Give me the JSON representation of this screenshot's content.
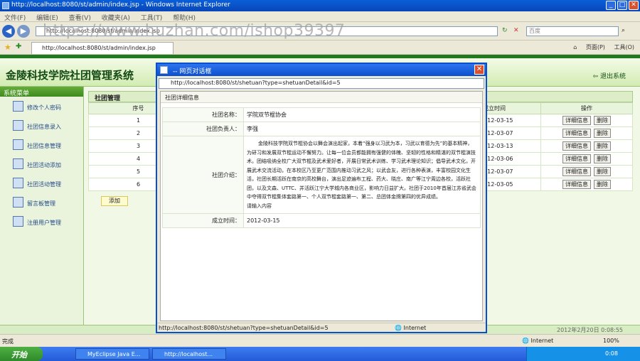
{
  "browser": {
    "window_title": "http://localhost:8080/st/admin/index.jsp - Windows Internet Explorer",
    "menu": [
      "文件(F)",
      "编辑(E)",
      "查看(V)",
      "收藏夹(A)",
      "工具(T)",
      "帮助(H)"
    ],
    "address": "http://localhost:8080/st/admin/index.jsp",
    "search_placeholder": "百度",
    "tab_title": "http://localhost:8080/st/admin/index.jsp",
    "tools": [
      "页面(P)",
      "工具(O)"
    ],
    "watermark": "https://www.huzhan.com/ishop39397",
    "status": "完成",
    "zone": "Internet",
    "zoom": "100%"
  },
  "app": {
    "title": "金陵科技学院社团管理系统",
    "logout": "退出系统",
    "sidebar_title": "系统菜单",
    "sidebar_items": [
      "修改个人密码",
      "社团信息录入",
      "社团信息管理",
      "社团活动添加",
      "社团活动管理",
      "留言板管理",
      "注册用户管理"
    ],
    "panel_title": "社团管理",
    "columns": {
      "no": "序号",
      "time": "成立时间",
      "op": "操作"
    },
    "rows": [
      {
        "no": "1",
        "time": "2012-03-15"
      },
      {
        "no": "2",
        "time": "2012-03-07"
      },
      {
        "no": "3",
        "time": "2012-03-13"
      },
      {
        "no": "4",
        "time": "2012-03-06"
      },
      {
        "no": "5",
        "time": "2012-03-07"
      },
      {
        "no": "6",
        "time": "2012-03-05"
      }
    ],
    "detail_label": "详细信息",
    "delete_label": "删除",
    "add_label": "添加",
    "footer_time": "2012年2月20日  0:08:55"
  },
  "dialog": {
    "title": "-- 网页对话框",
    "address": "http://localhost:8080/st/shetuan?type=shetuanDetail&id=5",
    "header": "社团详细信息",
    "fields": {
      "name_label": "社团名称：",
      "name_value": "学院双节棍协会",
      "leader_label": "社团负责人：",
      "leader_value": "李强",
      "intro_label": "社团介绍：",
      "intro_value": "金陵科技学院双节棍协会以舞会演出起家，本着“强身以习武为本，习武以育德为先”的基本精神，为研习和发展双节棍运动不懈努力。让每一位会员都能拥有强健的体魄、坚韧的性格和精湛的双节棍演技术。团结吸纳全校广大双节棍及武术爱好者，开展日常武术训练、学习武术理论知识；倡导武术文化，开展武术交流活动，在本校区乃至更广范围内推动习武之风；以武会友，进行各种表演，丰富校园文化生活，社团长期活跃在南京的高校舞台，演出足迹遍布工程、药大、晓庄、南广等江宁周边各校，活跃社团，以及文森、UTTC、并活跃江宁大学城内各商业区，影响力日益扩大。社团于2010年首届江苏省武会中夺得双节棍集体套路第一、个人双节棍套路第一、第二、总团体金牌第四的优异成绩。",
      "intro_tail": "请输入内容",
      "time_label": "成立时间：",
      "time_value": "2012-03-15"
    },
    "status_url": "http://localhost:8080/st/shetuan?type=shetuanDetail&id=5",
    "zone": "Internet"
  },
  "taskbar": {
    "start": "开始",
    "tasks": [
      "MyEclipse Java E...",
      "http://localhost..."
    ],
    "clock": "0:08"
  }
}
